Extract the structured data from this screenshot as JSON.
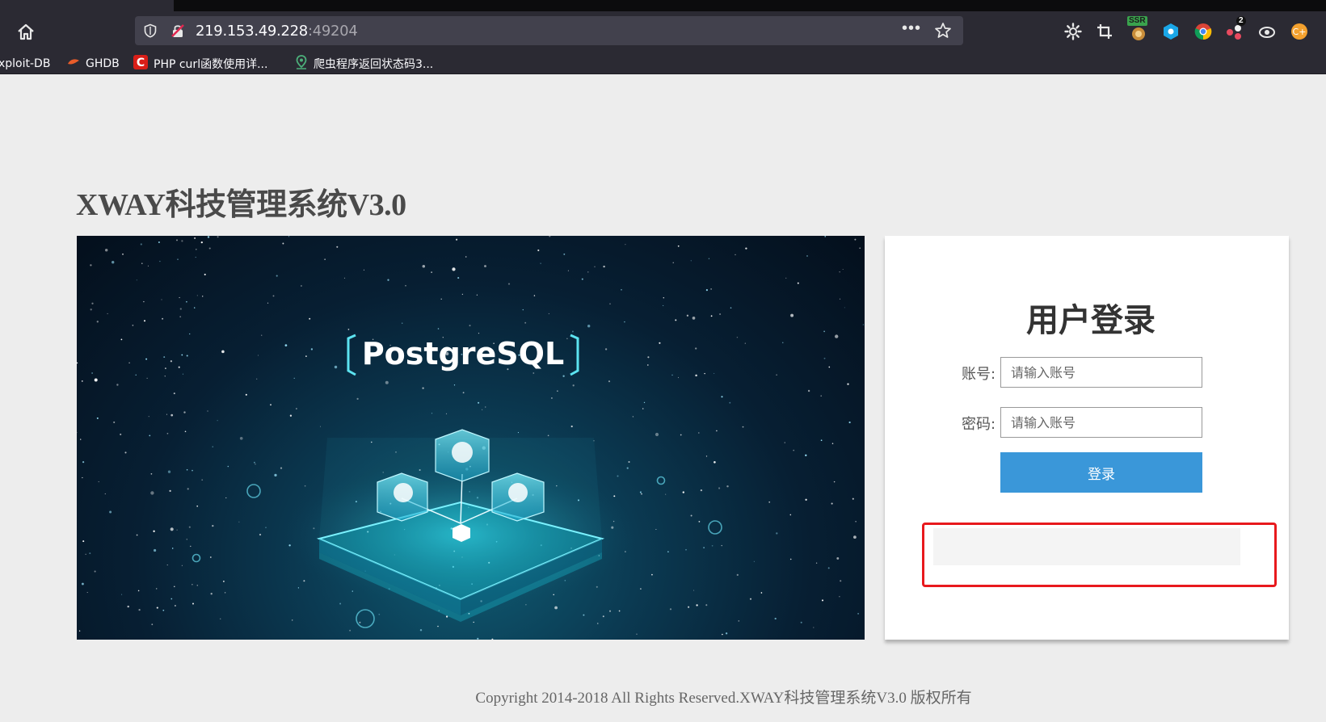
{
  "browser": {
    "url_host": "219.153.49.228",
    "url_port": ":49204",
    "more_menu": "•••",
    "extension_badges": {
      "ssr": "SSR",
      "notify_count": "2"
    },
    "bookmarks": [
      {
        "label": "xploit-DB",
        "icon": "exploit-db-icon"
      },
      {
        "label": "GHDB",
        "icon": "ghdb-icon"
      },
      {
        "label": "PHP curl函数使用详...",
        "icon": "csdn-icon"
      },
      {
        "label": "爬虫程序返回状态码3...",
        "icon": "location-pin-icon"
      }
    ]
  },
  "page": {
    "title": "XWAY科技管理系统V3.0",
    "banner_text": "PostgreSQL",
    "login": {
      "heading": "用户登录",
      "username_label": "账号:",
      "username_placeholder": "请输入账号",
      "password_label": "密码:",
      "password_placeholder": "请输入账号",
      "submit_label": "登录"
    },
    "footer": "Copyright 2014-2018 All Rights Reserved.XWAY科技管理系统V3.0 版权所有"
  },
  "colors": {
    "page_bg": "#ededed",
    "login_button": "#3a97d9",
    "highlight_box": "#e8191d",
    "browser_chrome": "#2b2a33"
  }
}
